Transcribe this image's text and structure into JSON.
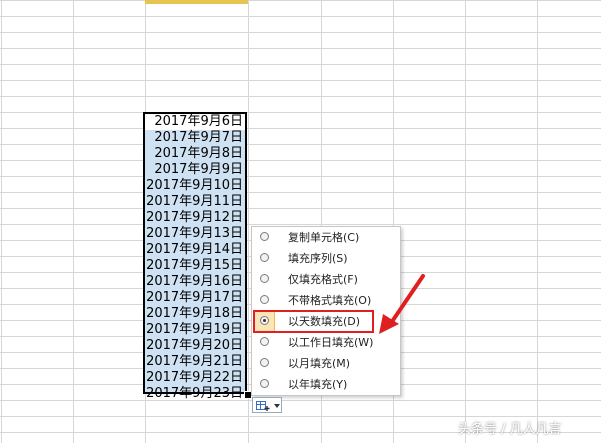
{
  "spreadsheet": {
    "dates": [
      "2017年9月6日",
      "2017年9月7日",
      "2017年9月8日",
      "2017年9月9日",
      "2017年9月10日",
      "2017年9月11日",
      "2017年9月12日",
      "2017年9月13日",
      "2017年9月14日",
      "2017年9月15日",
      "2017年9月16日",
      "2017年9月17日",
      "2017年9月18日",
      "2017年9月19日",
      "2017年9月20日",
      "2017年9月21日",
      "2017年9月22日",
      "2017年9月23日"
    ]
  },
  "autofill_menu": {
    "items": [
      {
        "label": "复制单元格(C)",
        "checked": false
      },
      {
        "label": "填充序列(S)",
        "checked": false
      },
      {
        "label": "仅填充格式(F)",
        "checked": false
      },
      {
        "label": "不带格式填充(O)",
        "checked": false
      },
      {
        "label": "以天数填充(D)",
        "checked": true
      },
      {
        "label": "以工作日填充(W)",
        "checked": false
      },
      {
        "label": "以月填充(M)",
        "checked": false
      },
      {
        "label": "以年填充(Y)",
        "checked": false
      }
    ],
    "icon": "autofill-options-icon"
  },
  "annotation": {
    "highlight_color": "#e02020",
    "arrow_color": "#e02020"
  },
  "watermark": "头条号 / 凡人凡言"
}
